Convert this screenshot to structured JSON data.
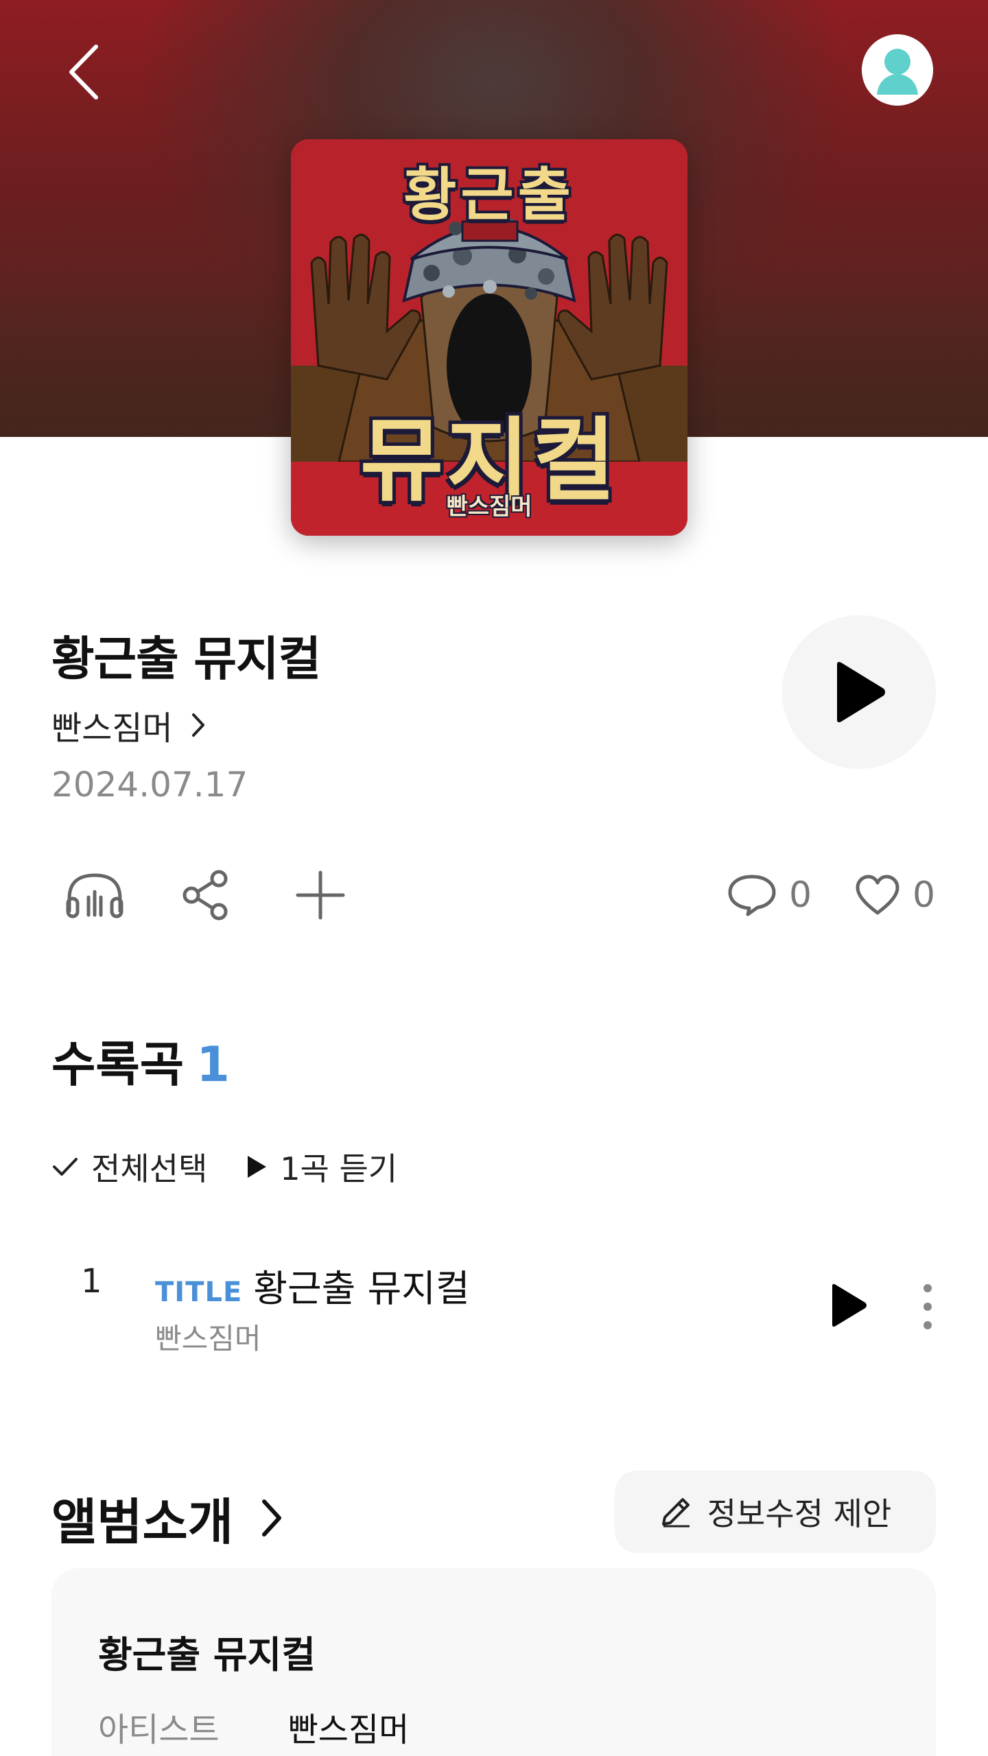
{
  "header": {
    "back_icon": "chevron-left-icon",
    "profile_icon": "user-avatar-icon"
  },
  "cover": {
    "top_text": "황근출",
    "badge_text": "황근출",
    "bottom_text": "뮤지컬",
    "artist_text": "빤스짐머",
    "bg_color": "#b8232b"
  },
  "album": {
    "title": "황근출 뮤지컬",
    "artist": "빤스짐머",
    "release_date": "2024.07.17"
  },
  "actions": {
    "listen_icon": "headphones-icon",
    "share_icon": "share-icon",
    "add_icon": "plus-icon",
    "comment_count": "0",
    "like_count": "0"
  },
  "tracklist": {
    "section_label": "수록곡",
    "count": "1",
    "select_all": "전체선택",
    "play_all": "1곡 듣기",
    "tracks": [
      {
        "number": "1",
        "badge": "TITLE",
        "title": "황근출 뮤지컬",
        "artist": "빤스짐머"
      }
    ]
  },
  "intro": {
    "section_label": "앨범소개",
    "suggest_edit": "정보수정 제안",
    "card_title": "황근출 뮤지컬",
    "artist_key": "아티스트",
    "artist_value": "빤스짐머"
  },
  "colors": {
    "accent_blue": "#4a90d9",
    "hero_red": "#8f1d22"
  }
}
